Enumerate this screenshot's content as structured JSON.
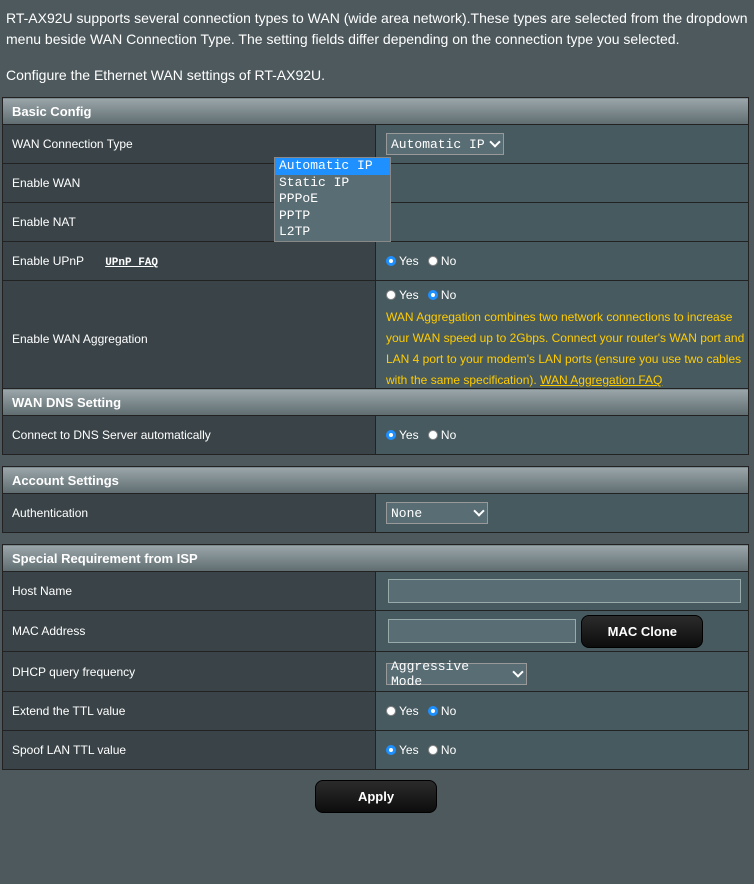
{
  "intro": {
    "line1": "RT-AX92U supports several connection types to WAN (wide area network).These types are selected from the dropdown menu beside WAN Connection Type. The setting fields differ depending on the connection type you selected.",
    "line2": "Configure the Ethernet WAN settings of RT-AX92U."
  },
  "basic": {
    "header": "Basic Config",
    "wan_type_label": "WAN Connection Type",
    "wan_type_value": "Automatic IP",
    "wan_type_options": [
      "Automatic IP",
      "Static IP",
      "PPPoE",
      "PPTP",
      "L2TP"
    ],
    "enable_wan_label": "Enable WAN",
    "enable_nat_label": "Enable NAT",
    "enable_upnp_label": "Enable UPnP",
    "upnp_faq": "UPnP FAQ",
    "aggregation_label": "Enable WAN Aggregation",
    "aggregation_note": "WAN Aggregation combines two network connections to increase your WAN speed up to 2Gbps. Connect your router's WAN port and LAN 4 port to your modem's LAN ports (ensure you use two cables with the same specification).",
    "aggregation_faq": "WAN Aggregation FAQ"
  },
  "radio": {
    "yes": "Yes",
    "no": "No"
  },
  "dns": {
    "header": "WAN DNS Setting",
    "auto_label": "Connect to DNS Server automatically"
  },
  "account": {
    "header": "Account Settings",
    "auth_label": "Authentication",
    "auth_value": "None"
  },
  "isp": {
    "header": "Special Requirement from ISP",
    "host_label": "Host Name",
    "host_value": "",
    "mac_label": "MAC Address",
    "mac_value": "",
    "mac_clone": "MAC Clone",
    "dhcp_label": "DHCP query frequency",
    "dhcp_value": "Aggressive Mode",
    "ttl_label": "Extend the TTL value",
    "spoof_label": "Spoof LAN TTL value"
  },
  "apply": "Apply",
  "colors": {
    "accent": "#1e90ff",
    "note": "#ffcc00",
    "background": "#4d595d"
  }
}
